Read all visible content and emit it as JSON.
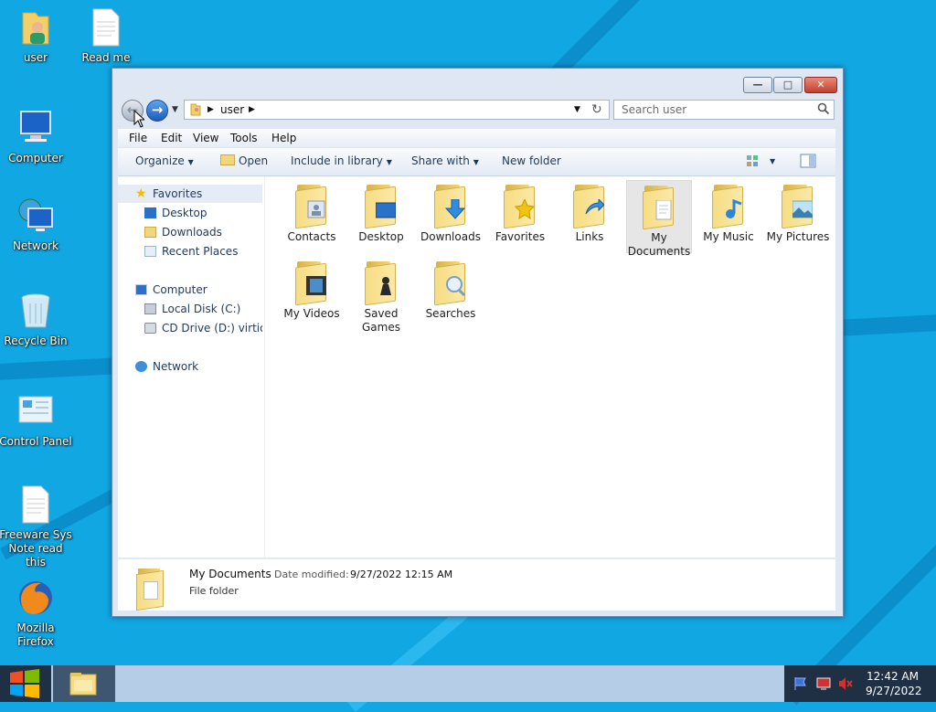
{
  "desktop": {
    "icons": [
      {
        "label": "user"
      },
      {
        "label": "Read me"
      },
      {
        "label": "Computer"
      },
      {
        "label": "Network"
      },
      {
        "label": "Recycle Bin"
      },
      {
        "label": "Control Panel"
      },
      {
        "label": "Freeware Sys Note read this"
      },
      {
        "label": "Mozilla Firefox"
      }
    ]
  },
  "window": {
    "address_path": [
      "user"
    ],
    "search_placeholder": "Search user",
    "menu": [
      "File",
      "Edit",
      "View",
      "Tools",
      "Help"
    ],
    "toolbar": {
      "organize": "Organize",
      "open": "Open",
      "include_in_library": "Include in library",
      "share_with": "Share with",
      "new_folder": "New folder"
    },
    "nav": {
      "favorites": "Favorites",
      "desktop": "Desktop",
      "downloads": "Downloads",
      "recent_places": "Recent Places",
      "computer": "Computer",
      "local_disk": "Local Disk (C:)",
      "cd_drive": "CD Drive (D:) virtio-w",
      "network": "Network"
    },
    "folders": [
      {
        "name": "Contacts",
        "icon": "contacts-icon"
      },
      {
        "name": "Desktop",
        "icon": "desktop-icon"
      },
      {
        "name": "Downloads",
        "icon": "download-arrow-icon"
      },
      {
        "name": "Favorites",
        "icon": "star-icon"
      },
      {
        "name": "Links",
        "icon": "link-arrow-icon"
      },
      {
        "name": "My Documents",
        "icon": "document-icon",
        "selected": true
      },
      {
        "name": "My Music",
        "icon": "music-note-icon"
      },
      {
        "name": "My Pictures",
        "icon": "picture-icon"
      },
      {
        "name": "My Videos",
        "icon": "film-icon"
      },
      {
        "name": "Saved Games",
        "icon": "chess-piece-icon"
      },
      {
        "name": "Searches",
        "icon": "magnifier-icon"
      }
    ],
    "details": {
      "name": "My Documents",
      "modified_label": "Date modified:",
      "modified_value": "9/27/2022 12:15 AM",
      "type": "File folder"
    }
  },
  "taskbar": {
    "time": "12:42 AM",
    "date": "9/27/2022"
  },
  "colors": {
    "desktop": "#10a7e3",
    "accent": "#1d5bb8"
  }
}
